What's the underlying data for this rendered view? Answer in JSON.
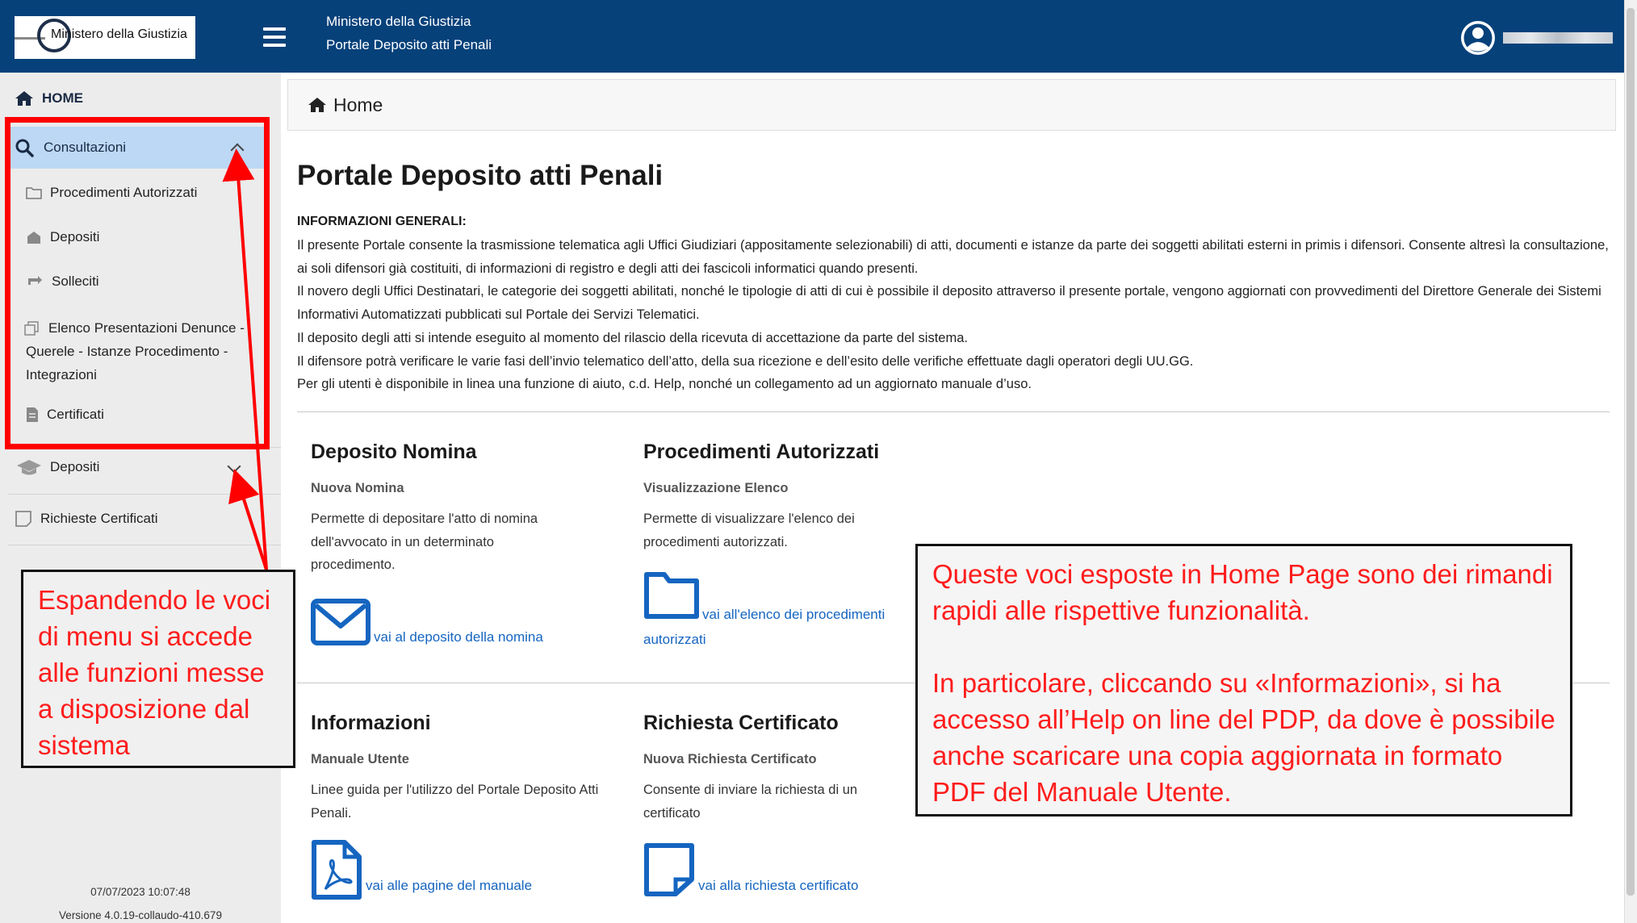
{
  "header": {
    "logo_text": "Ministero della Giustizia",
    "title_line1": "Ministero della Giustizia",
    "title_line2": "Portale Deposito atti Penali"
  },
  "sidebar": {
    "home": "HOME",
    "consultazioni": "Consultazioni",
    "sub_items": {
      "procedimenti": "Procedimenti Autorizzati",
      "depositi": "Depositi",
      "solleciti": "Solleciti",
      "elenco": "Elenco Presentazioni Denunce - Querele - Istanze Procedimento - Integrazioni",
      "certificati": "Certificati"
    },
    "depositi": "Depositi",
    "richieste": "Richieste Certificati",
    "timestamp": "07/07/2023 10:07:48",
    "version": "Versione 4.0.19-collaudo-410.679"
  },
  "breadcrumb": {
    "label": "Home"
  },
  "main": {
    "title": "Portale Deposito atti Penali",
    "info_heading": "INFORMAZIONI GENERALI:",
    "info_paragraphs": [
      "Il presente Portale consente la trasmissione telematica agli Uffici Giudiziari (appositamente selezionabili) di atti, documenti e istanze da parte dei soggetti abilitati esterni in primis i difensori. Consente altresì la consultazione, ai soli difensori già costituiti, di informazioni di registro e degli atti dei fascicoli informatici quando presenti.",
      "Il novero degli Uffici Destinatari, le categorie dei soggetti abilitati, nonché le tipologie di atti di cui è possibile il deposito attraverso il presente portale, vengono aggiornati con provvedimenti del Direttore Generale dei Sistemi Informativi Automatizzati pubblicati sul Portale dei Servizi Telematici.",
      "Il deposito degli atti si intende eseguito al momento del rilascio della ricevuta di accettazione da parte del sistema.",
      "Il difensore potrà verificare le varie fasi dell’invio telematico dell’atto, della sua ricezione e dell’esito delle verifiche effettuate dagli operatori degli UU.GG.",
      "Per gli utenti è disponibile in linea una funzione di aiuto, c.d. Help, nonché un collegamento ad un aggiornato manuale d’uso."
    ],
    "cards": {
      "nomina": {
        "title": "Deposito Nomina",
        "subtitle": "Nuova Nomina",
        "description": "Permette di depositare l'atto di nomina dell'avvocato in un determinato procedimento.",
        "link": "vai al deposito della nomina"
      },
      "procedimenti": {
        "title": "Procedimenti Autorizzati",
        "subtitle": "Visualizzazione Elenco",
        "description": "Permette di visualizzare l'elenco dei procedimenti autorizzati.",
        "link": "vai all'elenco dei procedimenti autorizzati"
      },
      "informazioni": {
        "title": "Informazioni",
        "subtitle": "Manuale Utente",
        "description": "Linee guida per l'utilizzo del Portale Deposito Atti Penali.",
        "link": "vai alle pagine del manuale"
      },
      "certificato": {
        "title": "Richiesta Certificato",
        "subtitle": "Nuova Richiesta Certificato",
        "description": "Consente di inviare la richiesta di un certificato",
        "link": "vai alla richiesta certificato"
      }
    }
  },
  "annotations": {
    "left": "Espandendo le voci di menu si accede alle funzioni messe a disposizione dal sistema",
    "right_p1": "Queste voci esposte in Home Page sono dei rimandi rapidi alle rispettive funzionalità.",
    "right_p2": "In particolare, cliccando su «Informazioni», si ha accesso all’Help on line del PDP, da dove è possibile anche scaricare una copia aggiornata in formato PDF del Manuale Utente."
  },
  "colors": {
    "header_bg": "#06417a",
    "active_menu_bg": "#bcd8f4",
    "link": "#1565c0",
    "annotation_red": "#ff0000"
  }
}
